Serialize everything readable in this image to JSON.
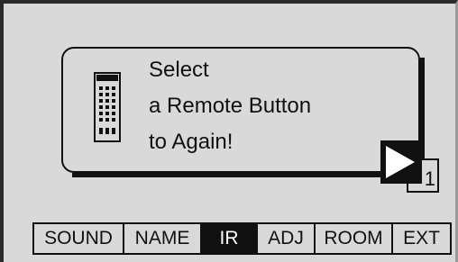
{
  "dialog": {
    "message_lines": [
      "Select",
      "a Remote Button",
      "to Again!"
    ],
    "page_number": "1",
    "icons": {
      "remote": "remote-control-icon",
      "next": "next-arrow-icon"
    }
  },
  "menu": {
    "tabs": [
      {
        "label": "SOUND",
        "active": false
      },
      {
        "label": "NAME",
        "active": false
      },
      {
        "label": "IR",
        "active": true
      },
      {
        "label": "ADJ",
        "active": false
      },
      {
        "label": "ROOM",
        "active": false
      },
      {
        "label": "EXT",
        "active": false
      }
    ]
  },
  "colors": {
    "background": "#d9d9d9",
    "foreground": "#111111",
    "active_tab_bg": "#111111",
    "active_tab_fg": "#ffffff"
  }
}
